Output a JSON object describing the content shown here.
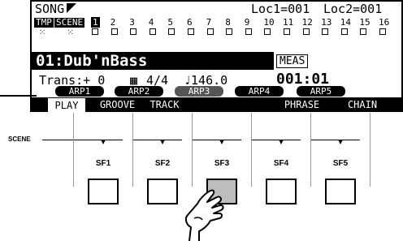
{
  "screen": {
    "title": "SONG",
    "loc1": "Loc1=001",
    "loc2": "Loc2=001",
    "tempo_tab": "TMP",
    "scene_tab": "SCENE",
    "track_numbers": [
      "1",
      "2",
      "3",
      "4",
      "5",
      "6",
      "7",
      "8",
      "9",
      "10",
      "11",
      "12",
      "13",
      "14",
      "15",
      "16"
    ],
    "song_name": "01:Dub'nBass",
    "meas_label": "MEAS",
    "meas_value": "001:01",
    "trans_label": "Trans:+ 0",
    "time_signature": "4/4",
    "tempo": "♩146.0",
    "arp_buttons": [
      "ARP1",
      "ARP2",
      "ARP3",
      "ARP4",
      "ARP5"
    ],
    "active_arp": "ARP3",
    "tabs": [
      "PLAY",
      "GROOVE",
      "TRACK",
      "PHRASE",
      "CHAIN"
    ],
    "active_tab": "PLAY"
  },
  "panel": {
    "scene_label": "SCENE",
    "buttons": [
      "SF1",
      "SF2",
      "SF3",
      "SF4",
      "SF5"
    ],
    "pressed": "SF3"
  }
}
